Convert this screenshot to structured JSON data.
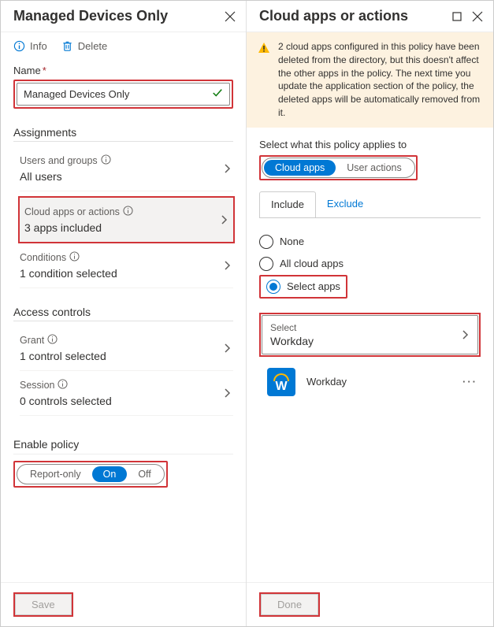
{
  "left": {
    "title": "Managed Devices Only",
    "toolbar": {
      "info": "Info",
      "delete": "Delete"
    },
    "nameLabel": "Name",
    "nameValue": "Managed Devices Only",
    "assignments": {
      "header": "Assignments",
      "usersGroups": {
        "label": "Users and groups",
        "value": "All users"
      },
      "cloudApps": {
        "label": "Cloud apps or actions",
        "value": "3 apps included"
      },
      "conditions": {
        "label": "Conditions",
        "value": "1 condition selected"
      }
    },
    "accessControls": {
      "header": "Access controls",
      "grant": {
        "label": "Grant",
        "value": "1 control selected"
      },
      "session": {
        "label": "Session",
        "value": "0 controls selected"
      }
    },
    "enablePolicy": {
      "label": "Enable policy",
      "options": [
        "Report-only",
        "On",
        "Off"
      ]
    },
    "saveLabel": "Save"
  },
  "right": {
    "title": "Cloud apps or actions",
    "warning": "2 cloud apps configured in this policy have been deleted from the directory, but this doesn't affect the other apps in the policy. The next time you update the application section of the policy, the deleted apps will be automatically removed from it.",
    "selectWhatLabel": "Select what this policy applies to",
    "pills": [
      "Cloud apps",
      "User actions"
    ],
    "tabs": [
      "Include",
      "Exclude"
    ],
    "radios": {
      "none": "None",
      "all": "All cloud apps",
      "select": "Select apps"
    },
    "selectBox": {
      "label": "Select",
      "value": "Workday"
    },
    "app": {
      "name": "Workday",
      "letter": "W"
    },
    "doneLabel": "Done"
  }
}
